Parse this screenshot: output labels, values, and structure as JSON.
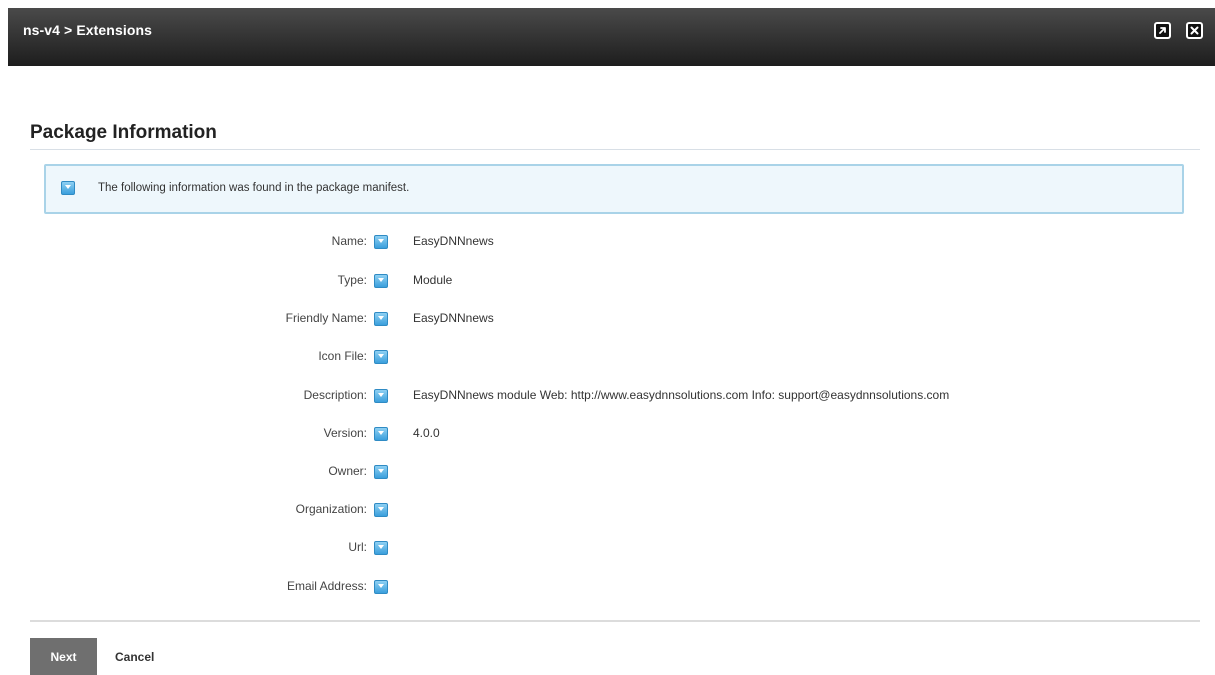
{
  "window": {
    "title": "ns-v4 > Extensions",
    "maximize_icon": "external-link-icon",
    "close_icon": "close-icon"
  },
  "section": {
    "title": "Package Information"
  },
  "info": {
    "icon": "info-icon",
    "message": "The following information was found in the package manifest."
  },
  "fields": [
    {
      "label": "Name:",
      "value": "EasyDNNnews"
    },
    {
      "label": "Type:",
      "value": "Module"
    },
    {
      "label": "Friendly Name:",
      "value": "EasyDNNnews"
    },
    {
      "label": "Icon File:",
      "value": ""
    },
    {
      "label": "Description:",
      "value": "EasyDNNnews module Web: http://www.easydnnsolutions.com Info: support@easydnnsolutions.com"
    },
    {
      "label": "Version:",
      "value": "4.0.0"
    },
    {
      "label": "Owner:",
      "value": ""
    },
    {
      "label": "Organization:",
      "value": ""
    },
    {
      "label": "Url:",
      "value": ""
    },
    {
      "label": "Email Address:",
      "value": ""
    }
  ],
  "actions": {
    "next_label": "Next",
    "cancel_label": "Cancel"
  },
  "colors": {
    "titlebar": "#2b2b2b",
    "info_border": "#a9d3e8",
    "info_background": "#eef7fc",
    "help_icon": "#3a9fdc",
    "next_button": "#6f6f6f"
  }
}
